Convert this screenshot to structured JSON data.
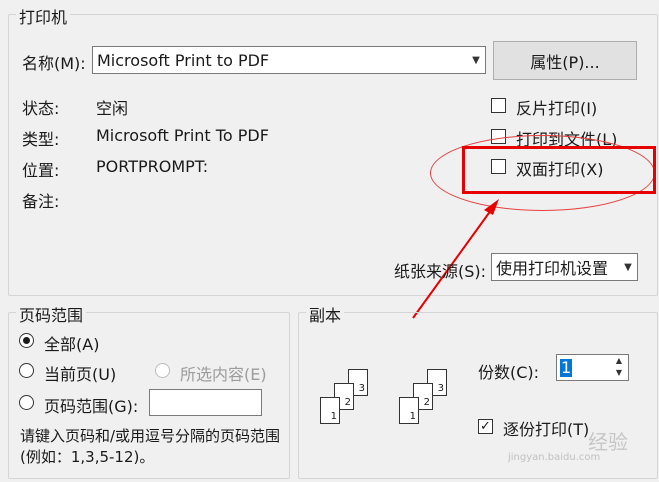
{
  "printer": {
    "group_title": "打印机",
    "name_label": "名称(M):",
    "name_value": "Microsoft Print to PDF",
    "properties_button": "属性(P)...",
    "status_label": "状态:",
    "status_value": "空闲",
    "type_label": "类型:",
    "type_value": "Microsoft Print To PDF",
    "location_label": "位置:",
    "location_value": "PORTPROMPT:",
    "comment_label": "备注:",
    "reverse_print": {
      "label": "反片打印(I)",
      "checked": false
    },
    "print_to_file": {
      "label": "打印到文件(L)",
      "checked": false
    },
    "duplex_print": {
      "label": "双面打印(X)",
      "checked": false
    },
    "paper_source_label": "纸张来源(S):",
    "paper_source_value": "使用打印机设置"
  },
  "page_range": {
    "group_title": "页码范围",
    "all": {
      "label": "全部(A)",
      "selected": true
    },
    "current_page": {
      "label": "当前页(U)",
      "selected": false
    },
    "selection": {
      "label": "所选内容(E)",
      "selected": false,
      "disabled": true
    },
    "pages": {
      "label": "页码范围(G):",
      "selected": false,
      "value": ""
    },
    "hint": "请键入页码和/或用逗号分隔的页码范围(例如：1,3,5-12)。"
  },
  "copies": {
    "group_title": "副本",
    "count_label": "份数(C):",
    "count_value": "1",
    "collate": {
      "label": "逐份打印(T)",
      "checked": true
    },
    "page_numbers": [
      "1",
      "2",
      "3"
    ]
  },
  "watermark": {
    "text": "经验",
    "url": "jingyan.baidu.com"
  },
  "colors": {
    "annotation": "#e60000",
    "dialog_bg": "#f0f0f0"
  }
}
